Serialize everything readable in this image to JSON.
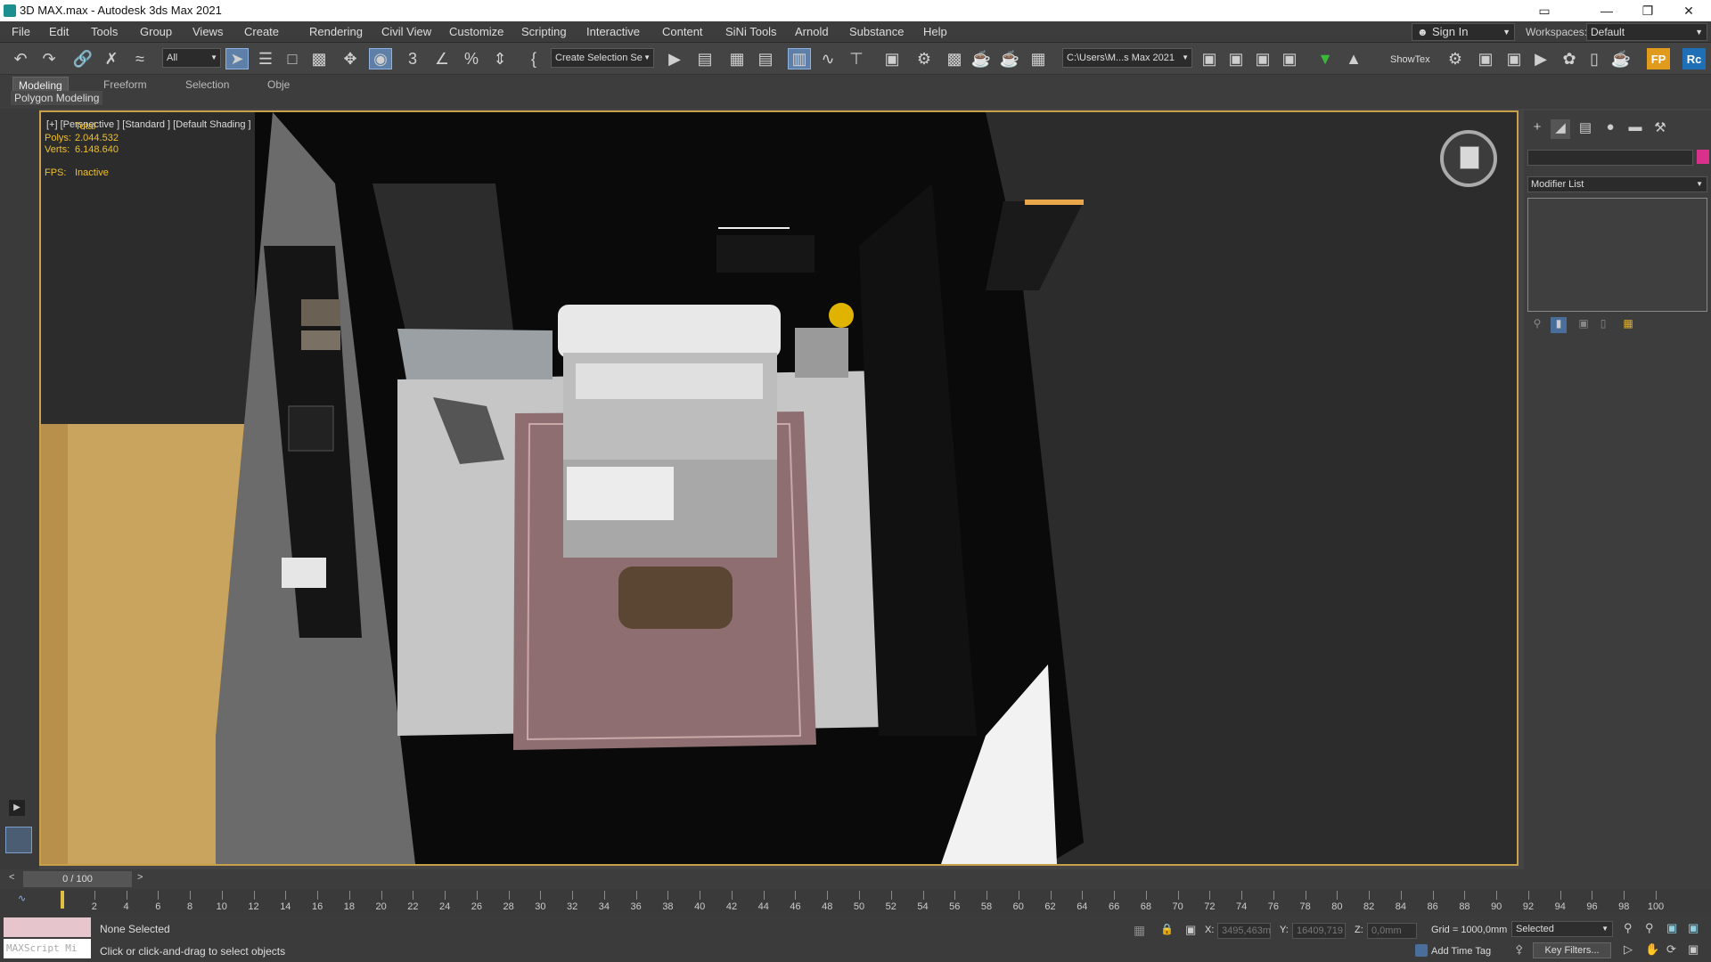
{
  "window": {
    "title": "3D MAX.max - Autodesk 3ds Max 2021",
    "controls": [
      "▭",
      "—",
      "❐",
      "✕"
    ]
  },
  "menu": [
    "File",
    "Edit",
    "Tools",
    "Group",
    "Views",
    "Create",
    "Rendering",
    "Civil View",
    "Customize",
    "Scripting",
    "Interactive",
    "Content",
    "SiNi Tools",
    "Arnold",
    "Substance",
    "Help"
  ],
  "account": {
    "sign_in": "Sign In",
    "workspaces_label": "Workspaces:",
    "workspace": "Default"
  },
  "toolbar": {
    "filter": "All",
    "selection_set": "Create Selection Se",
    "project_path": "C:\\Users\\M...s Max 2021",
    "show_tex": "ShowTex",
    "icons": [
      "undo-icon",
      "redo-icon",
      "link-icon",
      "unlink-icon",
      "bind-spacewarp-icon",
      "select-object-icon",
      "select-by-name-icon",
      "select-region-icon",
      "select-window-icon",
      "move-icon",
      "rotate-icon",
      "scale-icon",
      "snap-icon",
      "angle-snap-icon",
      "percent-snap-icon",
      "spinner-snap-icon",
      "mirror-icon",
      "align-icon",
      "layer-explorer-icon",
      "ribbon-icon",
      "schematic-icon",
      "material-editor-icon",
      "render-setup-icon",
      "render-frame-icon",
      "render-icon"
    ]
  },
  "ribbon": {
    "tabs": [
      "Modeling",
      "Freeform",
      "Selection",
      "Obje"
    ],
    "active_tab": "Modeling",
    "panel": "Polygon Modeling"
  },
  "viewport": {
    "label": "[+] [Perspective ] [Standard ] [Default Shading ]",
    "stats": {
      "header": "Total",
      "polys_label": "Polys:",
      "polys": "2.044.532",
      "verts_label": "Verts:",
      "verts": "6.148.640",
      "fps_label": "FPS:",
      "fps": "Inactive"
    }
  },
  "command_panel": {
    "tabs": [
      "create-icon",
      "modify-icon",
      "hierarchy-icon",
      "motion-icon",
      "display-icon",
      "utilities-icon"
    ],
    "modifier_list": "Modifier List",
    "object_color": "#d9308b"
  },
  "timeline": {
    "frame": "0 / 100",
    "ticks": [
      "2",
      "4",
      "6",
      "8",
      "10",
      "12",
      "14",
      "16",
      "18",
      "20",
      "22",
      "24",
      "26",
      "28",
      "30",
      "32",
      "34",
      "36",
      "38",
      "40",
      "42",
      "44",
      "46",
      "48",
      "50",
      "52",
      "54",
      "56",
      "58",
      "60",
      "62",
      "64",
      "66",
      "68",
      "70",
      "72",
      "74",
      "76",
      "78",
      "80",
      "82",
      "84",
      "86",
      "88",
      "90",
      "92",
      "94",
      "96",
      "98",
      "100"
    ]
  },
  "status": {
    "selection": "None Selected",
    "prompt": "Click or click-and-drag to select objects",
    "maxscript": "MAXScript Mi",
    "x_label": "X:",
    "x": "3495,463m",
    "y_label": "Y:",
    "y": "16409,719",
    "z_label": "Z:",
    "z": "0,0mm",
    "grid": "Grid = 1000,0mm",
    "key_mode": "Selected",
    "add_time_tag": "Add Time Tag",
    "key_filters": "Key Filters..."
  }
}
